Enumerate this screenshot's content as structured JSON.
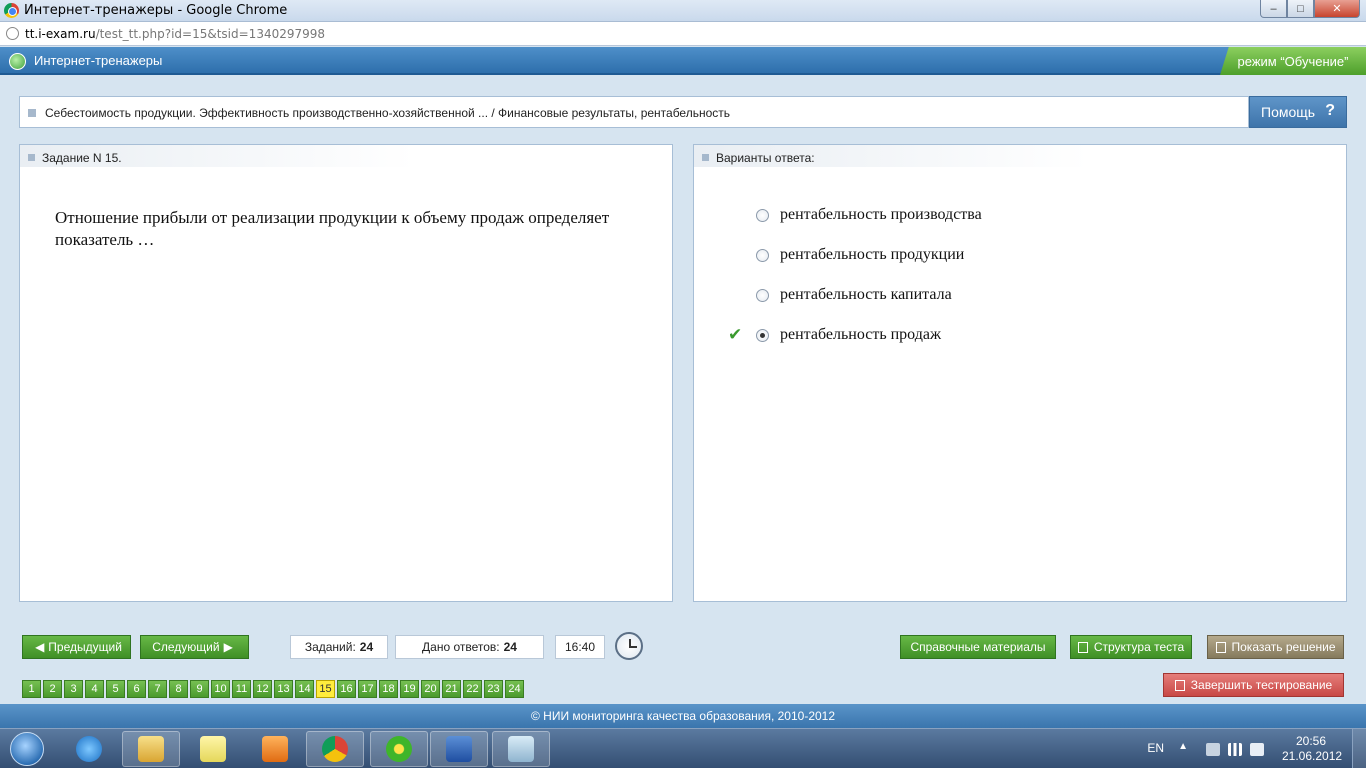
{
  "window": {
    "title": "Интернет-тренажеры - Google Chrome",
    "controls": {
      "minimize": "‒",
      "maximize": "□",
      "close": "✕"
    }
  },
  "address": {
    "host": "tt.i-exam.ru",
    "path": "/test_tt.php?id=15&tsid=1340297998"
  },
  "app": {
    "title": "Интернет-тренажеры",
    "mode": "режим “Обучение”"
  },
  "breadcrumb": "Себестоимость продукции. Эффективность производственно-хозяйственной ... / Финансовые результаты, рентабельность",
  "help": {
    "label": "Помощь",
    "icon": "?"
  },
  "task": {
    "header": "Задание N 15.",
    "question": "Отношение прибыли от реализации продукции к объему продаж определяет показатель …"
  },
  "answers": {
    "header": "Варианты ответа:",
    "options": [
      {
        "text": "рентабельность производства",
        "selected": false,
        "correct": false
      },
      {
        "text": "рентабельность продукции",
        "selected": false,
        "correct": false
      },
      {
        "text": "рентабельность капитала",
        "selected": false,
        "correct": false
      },
      {
        "text": "рентабельность продаж",
        "selected": true,
        "correct": true
      }
    ],
    "correct_mark": "✔"
  },
  "nav": {
    "prev": "Предыдущий",
    "next": "Следующий",
    "prev_arrow": "◀",
    "next_arrow": "▶"
  },
  "stats": {
    "tasks_label": "Заданий:",
    "tasks_value": "24",
    "answers_label": "Дано ответов:",
    "answers_value": "24",
    "time": "16:40"
  },
  "actions": {
    "reference": "Справочные материалы",
    "structure": "Структура теста",
    "solution": "Показать решение",
    "finish": "Завершить тестирование"
  },
  "pager": {
    "pages": [
      "1",
      "2",
      "3",
      "4",
      "5",
      "6",
      "7",
      "8",
      "9",
      "10",
      "11",
      "12",
      "13",
      "14",
      "15",
      "16",
      "17",
      "18",
      "19",
      "20",
      "21",
      "22",
      "23",
      "24"
    ],
    "current": "15"
  },
  "footer": "© НИИ мониторинга качества образования, 2010-2012",
  "taskbar": {
    "lang": "EN",
    "tray_arrow": "▲",
    "time": "20:56",
    "date": "21.06.2012"
  },
  "colors": {
    "header_blue": "#3a7ab8",
    "mode_green": "#5aab35",
    "button_green": "#4fa132",
    "pager_active": "#ffec3d",
    "finish_red": "#d4524f"
  }
}
